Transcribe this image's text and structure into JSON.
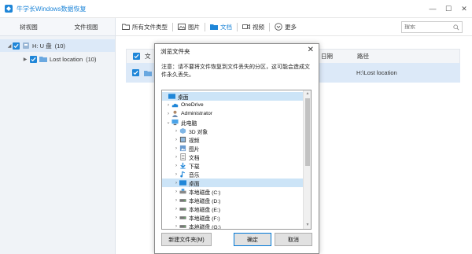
{
  "app": {
    "title": "牛学长Windows数据恢复",
    "controls": [
      "—",
      "☐",
      "✕"
    ]
  },
  "sidebar": {
    "tabs": [
      "树视图",
      "文件视图"
    ],
    "tree": [
      {
        "label": "H: U 盘",
        "count": "(10)"
      },
      {
        "label": "Lost location",
        "count": "(10)"
      }
    ]
  },
  "toolbar": {
    "items": [
      "所有文件类型",
      "图片",
      "文档",
      "视频",
      "更多"
    ],
    "search_placeholder": "搜索"
  },
  "table": {
    "headers": [
      "文",
      "日期",
      "路径"
    ],
    "row": {
      "path": "H:\\Lost location"
    }
  },
  "dialog": {
    "title": "浏览文件夹",
    "close": "✕",
    "message": "注意：请不要将文件恢复到文件丢失的分区，这可能会造成文件永久丢失。",
    "tree": [
      {
        "label": "桌面"
      },
      {
        "label": "OneDrive"
      },
      {
        "label": "Administrator"
      },
      {
        "label": "此电脑"
      },
      {
        "label": "3D 对象"
      },
      {
        "label": "视频"
      },
      {
        "label": "图片"
      },
      {
        "label": "文档"
      },
      {
        "label": "下载"
      },
      {
        "label": "音乐"
      },
      {
        "label": "桌面"
      },
      {
        "label": "本地磁盘 (C:)"
      },
      {
        "label": "本地磁盘 (D:)"
      },
      {
        "label": "本地磁盘 (E:)"
      },
      {
        "label": "本地磁盘 (F:)"
      },
      {
        "label": "本地磁盘 (G:)"
      }
    ],
    "buttons": {
      "new_folder": "新建文件夹(M)",
      "ok": "确定",
      "cancel": "取消"
    }
  },
  "colors": {
    "accent": "#1f86d8",
    "sidebar_bg": "#f0f3f7",
    "selected_row": "#dce9f8"
  }
}
